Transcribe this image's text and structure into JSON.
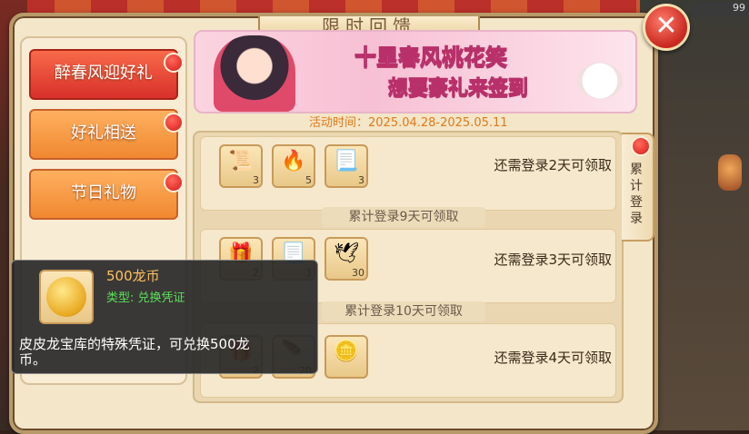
{
  "header": {
    "title": "限时回馈",
    "badge_count": "99"
  },
  "menu": {
    "items": [
      {
        "label": "醉春风迎好礼"
      },
      {
        "label": "好礼相送"
      },
      {
        "label": "节日礼物"
      }
    ]
  },
  "banner": {
    "line1": "十里春风桃花笑",
    "line2": "想要豪礼来签到",
    "time": "活动时间：2025.04.28-2025.05.11"
  },
  "side_tab": {
    "label": "累计登录"
  },
  "rows": [
    {
      "header": "",
      "status": "还需登录2天可领取",
      "items": [
        {
          "icon": "scroll-icon",
          "count": "3"
        },
        {
          "icon": "fire-pot-icon",
          "count": "5"
        },
        {
          "icon": "silver-scroll-icon",
          "count": "3"
        }
      ]
    },
    {
      "header": "累计登录9天可领取",
      "status": "还需登录3天可领取",
      "items": [
        {
          "icon": "gift-box-icon",
          "count": "2"
        },
        {
          "icon": "silver-scroll-icon",
          "count": "3"
        },
        {
          "icon": "crane-icon",
          "count": "30"
        }
      ]
    },
    {
      "header": "累计登录10天可领取",
      "status": "还需登录4天可领取",
      "items": [
        {
          "icon": "gift-box-icon",
          "count": "2"
        },
        {
          "icon": "wing-icon",
          "count": "20"
        },
        {
          "icon": "dragon-coin-icon",
          "count": ""
        }
      ]
    }
  ],
  "tooltip": {
    "name": "500龙币",
    "type": "类型: 兑换凭证",
    "description": "皮皮龙宝库的特殊凭证，可兑换500龙币。"
  },
  "colors": {
    "menu_active": "#d8302a",
    "menu_normal": "#f08830",
    "event_time": "#e07a1a",
    "tooltip_type": "#5ce05a"
  }
}
